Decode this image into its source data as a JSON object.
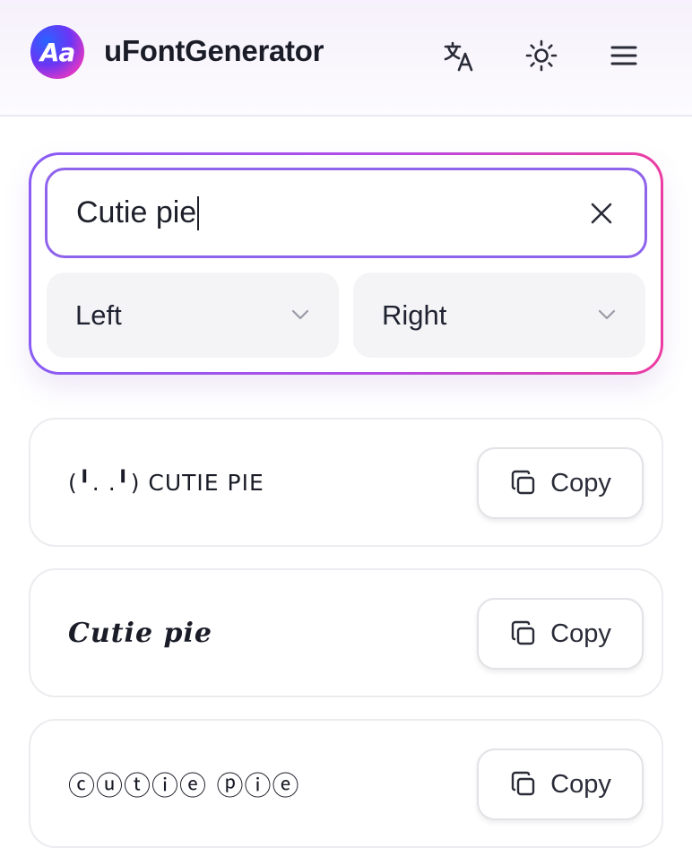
{
  "header": {
    "logo_text": "Aa",
    "title": "uFontGenerator",
    "icons": [
      "translate-icon",
      "sun-icon",
      "menu-icon"
    ]
  },
  "input": {
    "value": "Cutie pie",
    "clear_icon": "close-icon"
  },
  "selects": [
    {
      "value": "Left",
      "icon": "chevron-down-icon"
    },
    {
      "value": "Right",
      "icon": "chevron-down-icon"
    }
  ],
  "results": [
    {
      "text": "(╹. .╹) CUTIE PIE",
      "copy_label": "Copy"
    },
    {
      "text": "𝑪𝒖𝒕𝒊𝒆 𝒑𝒊𝒆",
      "copy_label": "Copy"
    },
    {
      "text": "ⓒⓤⓣⓘⓔ ⓟⓘⓔ",
      "copy_label": "Copy"
    }
  ],
  "colors": {
    "accent_purple": "#8f63ec",
    "accent_pink": "#ec3ca2"
  }
}
